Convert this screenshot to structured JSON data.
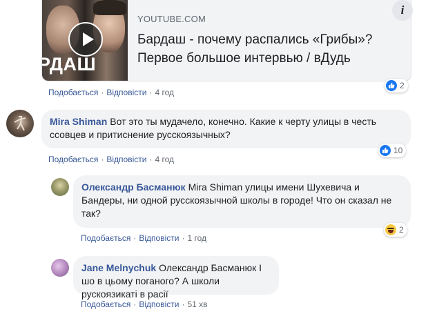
{
  "link_preview": {
    "source": "YOUTUBE.COM",
    "title": "Бардаш - почему распались «Грибы»? Первое большое интервью / вДудь",
    "thumbnail_text": "РДАШ",
    "info_label": "i"
  },
  "actions_labels": {
    "like": "Подобається",
    "reply": "Відповісти",
    "separator": "·"
  },
  "comments": [
    {
      "time": "4 год",
      "reaction_count": "2",
      "reaction_icon": "like-icon"
    },
    {
      "author": "Mira Shiman",
      "text": "Вот это ты мудачело, конечно. Какие к черту улицы в честь ссовцев и притиснение русскоязычных?",
      "time": "4 год",
      "reaction_count": "10",
      "reaction_icon": "like-icon"
    },
    {
      "author": "Олександр Басманюк",
      "text": "Mira Shiman улицы имени Шухевича и Бандеры, ни одной русскоязычной школы в городе! Что он сказал не так?",
      "time": "1 год",
      "reaction_count": "2",
      "reaction_icon": "haha-icon"
    },
    {
      "author": "Jane Melnychuk",
      "text": "Олександр Басманюк І шо в цьому поганого? А школи рускоязикаті в расії",
      "time": "51 хв"
    }
  ],
  "colors": {
    "link": "#385898",
    "bubble": "#f2f3f5",
    "like": "#1877f2",
    "meta": "#606770"
  }
}
